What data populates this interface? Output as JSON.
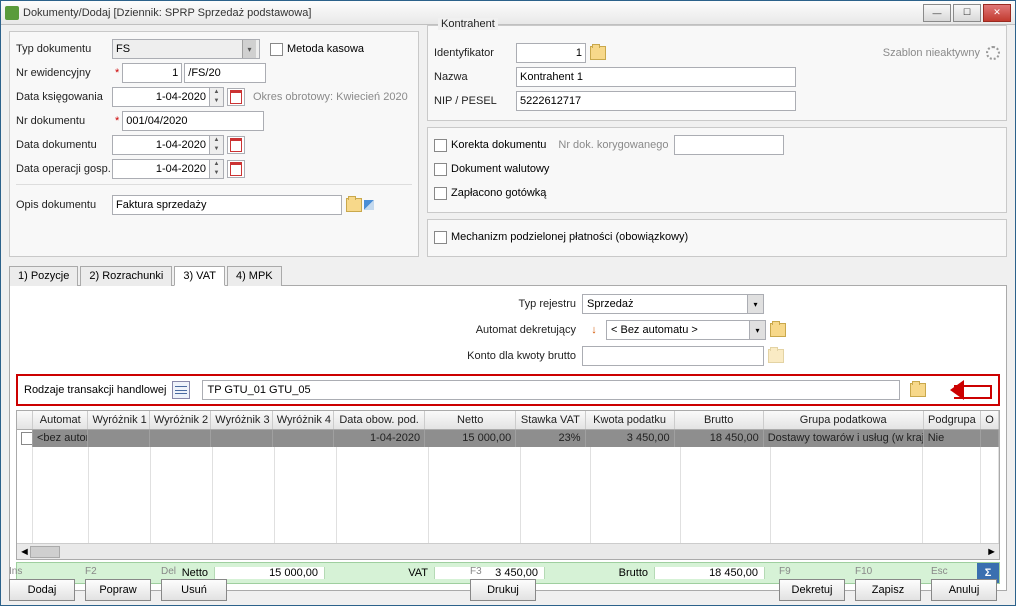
{
  "window": {
    "title": "Dokumenty/Dodaj [Dziennik: SPRP  Sprzedaż podstawowa]"
  },
  "doc": {
    "typ_label": "Typ dokumentu",
    "typ_value": "FS",
    "metoda_kasowa": "Metoda kasowa",
    "nr_ewid_label": "Nr ewidencyjny",
    "nr_ewid_value": "1",
    "nr_ewid_suffix": "/FS/20",
    "data_ksieg_label": "Data księgowania",
    "data_ksieg_value": "1-04-2020",
    "okres": "Okres obrotowy: Kwiecień 2020",
    "nr_dok_label": "Nr dokumentu",
    "nr_dok_value": "001/04/2020",
    "data_dok_label": "Data dokumentu",
    "data_dok_value": "1-04-2020",
    "data_oper_label": "Data operacji gosp.",
    "data_oper_value": "1-04-2020",
    "opis_label": "Opis dokumentu",
    "opis_value": "Faktura sprzedaży"
  },
  "kontrahent": {
    "title": "Kontrahent",
    "ident_label": "Identyfikator",
    "ident_value": "1",
    "szablon": "Szablon nieaktywny",
    "nazwa_label": "Nazwa",
    "nazwa_value": "Kontrahent 1",
    "nip_label": "NIP / PESEL",
    "nip_value": "5222612717",
    "korekta": "Korekta dokumentu",
    "nr_koryg": "Nr dok. korygowanego",
    "walutowy": "Dokument walutowy",
    "zaplacono": "Zapłacono gotówką",
    "mpp": "Mechanizm podzielonej płatności (obowiązkowy)"
  },
  "tabs": {
    "t1": "1) Pozycje",
    "t2": "2) Rozrachunki",
    "t3": "3) VAT",
    "t4": "4) MPK"
  },
  "vat": {
    "typ_rej_label": "Typ rejestru",
    "typ_rej_value": "Sprzedaż",
    "automat_label": "Automat dekretujący",
    "automat_value": "< Bez automatu >",
    "konto_label": "Konto dla kwoty brutto",
    "rodzaje_label": "Rodzaje transakcji handlowej",
    "rodzaje_value": "TP GTU_01 GTU_05"
  },
  "grid": {
    "headers": {
      "h0": "",
      "h1": "Automat",
      "h2": "Wyróżnik 1",
      "h3": "Wyróżnik 2",
      "h4": "Wyróżnik 3",
      "h5": "Wyróżnik 4",
      "h6": "Data obow. pod.",
      "h7": "Netto",
      "h8": "Stawka VAT",
      "h9": "Kwota podatku",
      "h10": "Brutto",
      "h11": "Grupa podatkowa",
      "h12": "Podgrupa",
      "h13": "O"
    },
    "row": {
      "automat": "<bez autom",
      "data": "1-04-2020",
      "netto": "15 000,00",
      "stawka": "23%",
      "podatek": "3 450,00",
      "brutto": "18 450,00",
      "grupa": "Dostawy towarów i usług (w kraju)",
      "podgr": "Nie"
    }
  },
  "totals": {
    "netto_label": "Netto",
    "netto_value": "15 000,00",
    "vat_label": "VAT",
    "vat_value": "3 450,00",
    "brutto_label": "Brutto",
    "brutto_value": "18 450,00"
  },
  "footer": {
    "ins": "Ins",
    "f2": "F2",
    "del": "Del",
    "f3": "F3",
    "f9": "F9",
    "f10": "F10",
    "esc": "Esc",
    "dodaj": "Dodaj",
    "popraw": "Popraw",
    "usun": "Usuń",
    "drukuj": "Drukuj",
    "dekretuj": "Dekretuj",
    "zapisz": "Zapisz",
    "anuluj": "Anuluj"
  }
}
